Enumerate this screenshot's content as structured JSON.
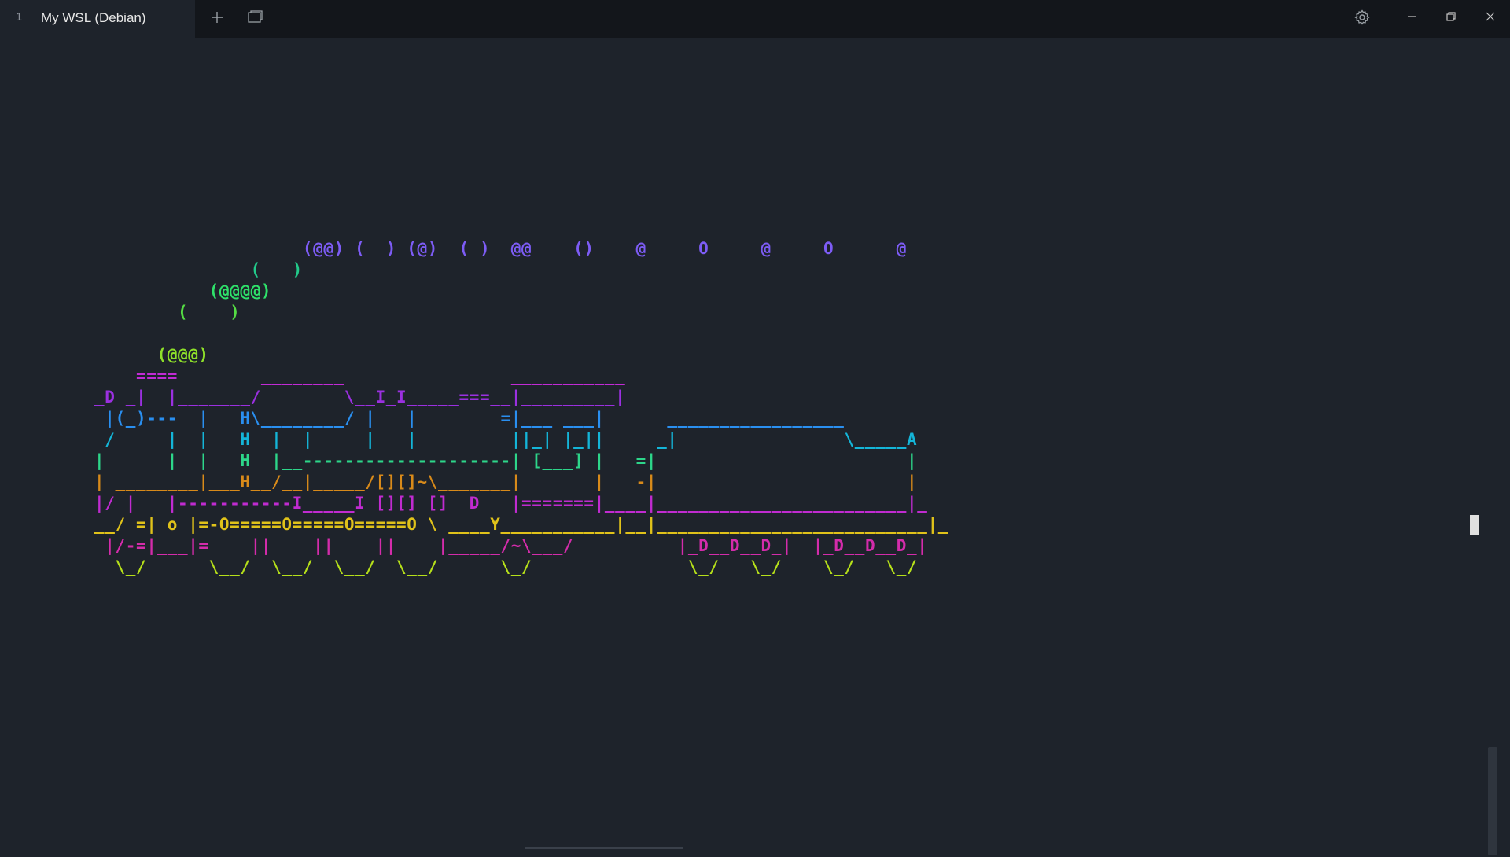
{
  "titlebar": {
    "tab_index": "1",
    "tab_title": "My WSL (Debian)",
    "icons": [
      "plus-icon",
      "split-pane-icon",
      "gear-icon",
      "minimize-icon",
      "restore-icon",
      "close-icon"
    ]
  },
  "terminal": {
    "art_lines": [
      {
        "text": "                    (@@) (  ) (@)  ( )  @@    ()    @     O     @     O      @",
        "color": "#7d5cf5"
      },
      {
        "text": "               (   )",
        "color": "#22c98a"
      },
      {
        "text": "           (@@@@)",
        "color": "#2ee06a"
      },
      {
        "text": "        (    )",
        "color": "#55dd44"
      },
      {
        "text": "",
        "color": "#55dd44"
      },
      {
        "text": "      (@@@)",
        "color": "#8ee02a"
      },
      {
        "text": "    ====        ________                ___________",
        "color": "#c22bd6"
      },
      {
        "text": "_D _|  |_______/        \\__I_I_____===__|_________|",
        "color": "#9b30e0"
      },
      {
        "text": " |(_)---  |   H\\________/ |   |        =|___ ___|      _________________",
        "color": "#2a8ff0"
      },
      {
        "text": " /     |  |   H  |  |     |   |         ||_| |_||     _|                \\_____A",
        "color": "#14b5d8"
      },
      {
        "text": "|      |  |   H  |__--------------------| [___] |   =|                        |",
        "color": "#2dd68a"
      },
      {
        "text": "| ________|___H__/__|_____/[][]~\\_______|       |   -|                        |",
        "color": "#d88a1a"
      },
      {
        "text": "|/ |   |-----------I_____I [][] []  D   |=======|____|________________________|_",
        "color": "#c02bd0"
      },
      {
        "text": "__/ =| o |=-O=====O=====O=====O \\ ____Y___________|__|__________________________|_",
        "color": "#e0c21a"
      },
      {
        "text": " |/-=|___|=    ||    ||    ||    |_____/~\\___/          |_D__D__D_|  |_D__D__D_|",
        "color": "#d42cab"
      },
      {
        "text": "  \\_/      \\__/  \\__/  \\__/  \\__/      \\_/               \\_/   \\_/    \\_/   \\_/",
        "color": "#b6e01a"
      }
    ]
  }
}
